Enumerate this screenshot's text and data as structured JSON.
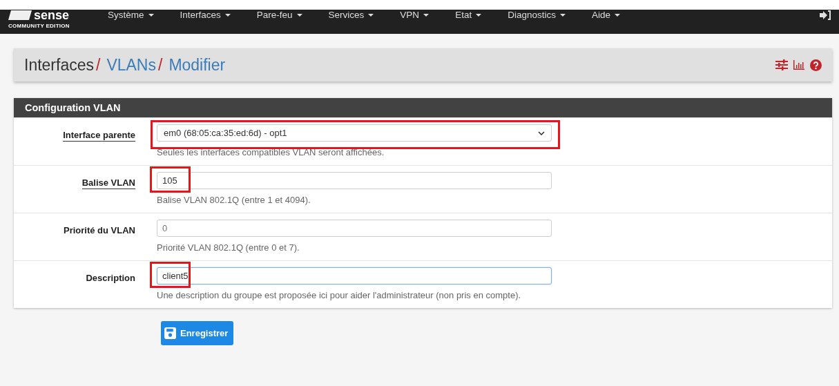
{
  "navbar": {
    "logo": {
      "wordmark": "sense",
      "edition": "COMMUNITY EDITION"
    },
    "menus": [
      {
        "label": "Système"
      },
      {
        "label": "Interfaces"
      },
      {
        "label": "Pare-feu"
      },
      {
        "label": "Services"
      },
      {
        "label": "VPN"
      },
      {
        "label": "Etat"
      },
      {
        "label": "Diagnostics"
      },
      {
        "label": "Aide"
      }
    ]
  },
  "breadcrumb": [
    {
      "label": "Interfaces",
      "link": false,
      "separator": "/"
    },
    {
      "label": "VLANs",
      "link": true,
      "separator": "/"
    },
    {
      "label": "Modifier",
      "link": true
    }
  ],
  "panel": {
    "title": "Configuration VLAN",
    "rows": [
      {
        "kind": "select",
        "label": "Interface parente",
        "label_underlined": true,
        "value": "em0 (68:05:ca:35:ed:6d) - opt1",
        "help": "Seules les interfaces compatibles VLAN seront affichées.",
        "highlighted": true,
        "focused": false
      },
      {
        "kind": "input",
        "label": "Balise VLAN",
        "label_underlined": true,
        "value": "105",
        "help": "Balise VLAN 802.1Q (entre 1 et 4094).",
        "highlighted": true,
        "focused": false
      },
      {
        "kind": "input",
        "label": "Priorité du VLAN",
        "label_underlined": false,
        "placeholder": "0",
        "help": "Priorité VLAN 802.1Q (entre 0 et 7).",
        "highlighted": false,
        "focused": false
      },
      {
        "kind": "input",
        "label": "Description",
        "label_underlined": false,
        "value": "client5",
        "help": "Une description du groupe est proposée ici pour aider l'administrateur (non pris en compte).",
        "highlighted": true,
        "focused": true
      }
    ]
  },
  "save_button": {
    "label": "Enregistrer"
  }
}
